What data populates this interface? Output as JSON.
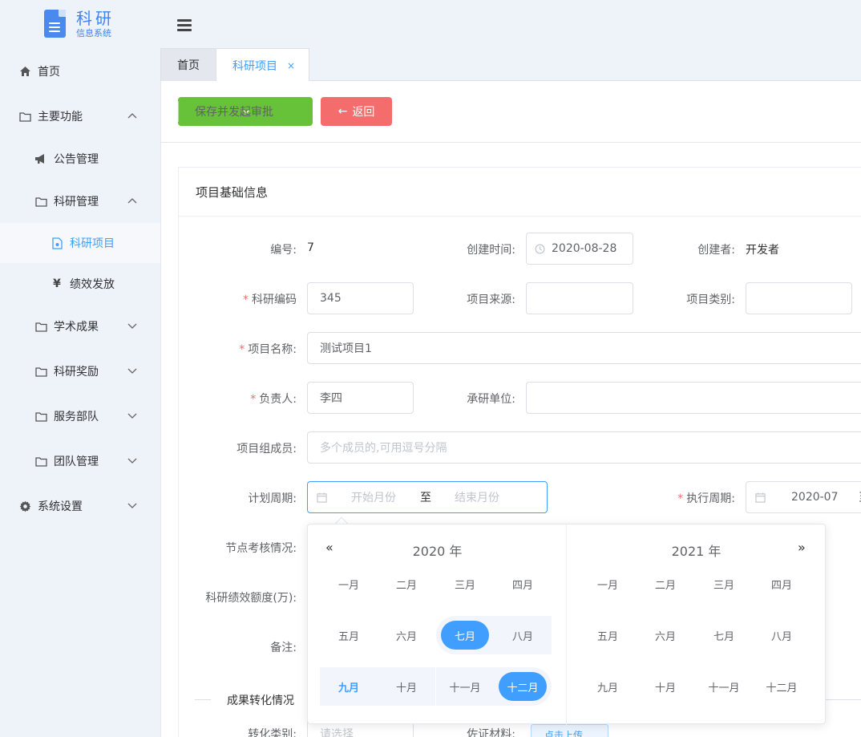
{
  "logo": {
    "title": "科研",
    "subtitle": "信息系统"
  },
  "sidebar": {
    "items": [
      {
        "label": "首页"
      },
      {
        "label": "主要功能"
      },
      {
        "label": "公告管理"
      },
      {
        "label": "科研管理"
      },
      {
        "label": "科研项目"
      },
      {
        "label": "绩效发放"
      },
      {
        "label": "学术成果"
      },
      {
        "label": "科研奖励"
      },
      {
        "label": "服务部队"
      },
      {
        "label": "团队管理"
      },
      {
        "label": "系统设置"
      }
    ]
  },
  "tabs": {
    "home": "首页",
    "active": "科研项目",
    "close": "×"
  },
  "toolbar": {
    "save_label": "保存并发起审批",
    "back_label": "返回",
    "back_arrow": "←"
  },
  "card": {
    "title": "项目基础信息"
  },
  "form": {
    "id_label": "编号:",
    "id_value": "7",
    "created_label": "创建时间:",
    "created_value": "2020-08-28",
    "creator_label": "创建者:",
    "creator_value": "开发者",
    "code_label": "科研编码",
    "code_value": "345",
    "source_label": "项目来源:",
    "category_label": "项目类别:",
    "name_label": "项目名称:",
    "name_value": "测试项目1",
    "owner_label": "负责人:",
    "owner_value": "李四",
    "unit_label": "承研单位:",
    "members_label": "项目组成员:",
    "members_placeholder": "多个成员的,可用逗号分隔",
    "plan_label": "计划周期:",
    "plan_start_placeholder": "开始月份",
    "plan_sep": "至",
    "plan_end_placeholder": "结束月份",
    "exec_label": "执行周期:",
    "exec_start": "2020-07",
    "exec_sep": "至",
    "node_label": "节点考核情况:",
    "quota_label": "科研绩效额度(万):",
    "remark_label": "备注:",
    "section2": "成果转化情况",
    "convert_label": "转化类别:",
    "convert_placeholder": "请选择",
    "proof_label": "佐证材料:",
    "upload_label": "点击上传"
  },
  "picker": {
    "left_year": "2020 年",
    "right_year": "2021 年",
    "prev": "«",
    "next": "»",
    "months": [
      "一月",
      "二月",
      "三月",
      "四月",
      "五月",
      "六月",
      "七月",
      "八月",
      "九月",
      "十月",
      "十一月",
      "十二月"
    ]
  }
}
